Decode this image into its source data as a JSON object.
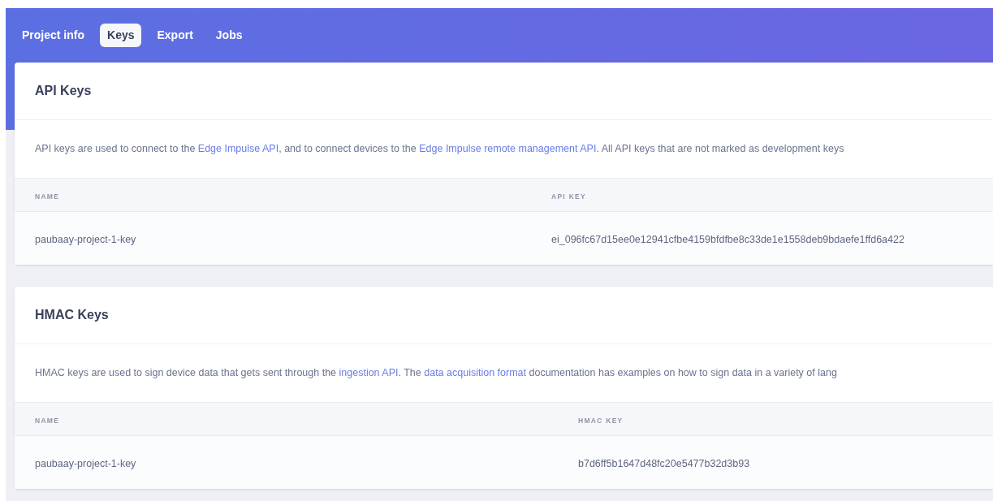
{
  "tabs": [
    {
      "label": "Project info",
      "selected": false
    },
    {
      "label": "Keys",
      "selected": true
    },
    {
      "label": "Export",
      "selected": false
    },
    {
      "label": "Jobs",
      "selected": false
    }
  ],
  "sections": [
    {
      "title": "API Keys",
      "description": [
        {
          "kind": "text",
          "text": "API keys are used to connect to the "
        },
        {
          "kind": "link",
          "text": "Edge Impulse API"
        },
        {
          "kind": "text",
          "text": ", and to connect devices to the "
        },
        {
          "kind": "link",
          "text": "Edge Impulse remote management API"
        },
        {
          "kind": "text",
          "text": ". All API keys that are not marked as development keys"
        }
      ],
      "columns": [
        "NAME",
        "API KEY"
      ],
      "rows": [
        [
          "paubaay-project-1-key",
          "ei_096fc67d15ee0e12941cfbe4159bfdfbe8c33de1e1558deb9bdaefe1ffd6a422"
        ]
      ]
    },
    {
      "title": "HMAC Keys",
      "description": [
        {
          "kind": "text",
          "text": "HMAC keys are used to sign device data that gets sent through the "
        },
        {
          "kind": "link",
          "text": "ingestion API"
        },
        {
          "kind": "text",
          "text": ". The "
        },
        {
          "kind": "link",
          "text": "data acquisition format"
        },
        {
          "kind": "text",
          "text": " documentation has examples on how to sign data in a variety of lang"
        }
      ],
      "columns": [
        "NAME",
        "HMAC KEY"
      ],
      "rows": [
        [
          "paubaay-project-1-key",
          "b7d6ff5b1647d48fc20e5477b32d3b93"
        ]
      ]
    }
  ]
}
